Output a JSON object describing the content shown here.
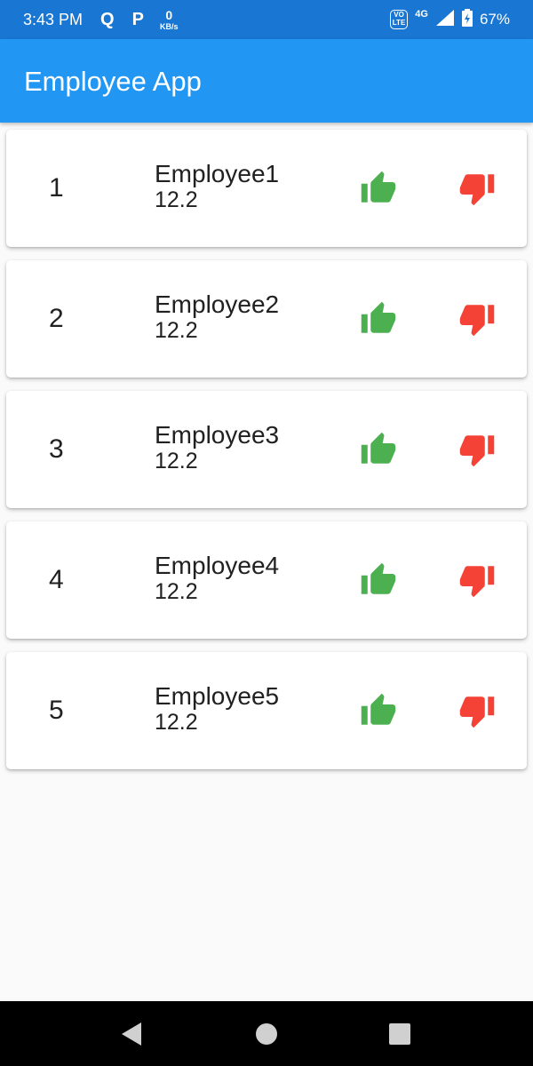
{
  "status_bar": {
    "time": "3:43 PM",
    "app_icons": [
      "Q",
      "P"
    ],
    "net_speed_value": "0",
    "net_speed_unit": "KB/s",
    "volte_label": "VO\nLTE",
    "network_type": "4G",
    "battery_percent": "67%"
  },
  "app_bar": {
    "title": "Employee App"
  },
  "colors": {
    "primary": "#2196f3",
    "status": "#1976d2",
    "like": "#4caf50",
    "dislike": "#f44336"
  },
  "employees": [
    {
      "index": "1",
      "name": "Employee1",
      "value": "12.2"
    },
    {
      "index": "2",
      "name": "Employee2",
      "value": "12.2"
    },
    {
      "index": "3",
      "name": "Employee3",
      "value": "12.2"
    },
    {
      "index": "4",
      "name": "Employee4",
      "value": "12.2"
    },
    {
      "index": "5",
      "name": "Employee5",
      "value": "12.2"
    }
  ],
  "icons": {
    "like": "thumb-up-icon",
    "dislike": "thumb-down-icon"
  },
  "nav_bar": {
    "buttons": [
      "back-icon",
      "home-icon",
      "recents-icon"
    ]
  }
}
